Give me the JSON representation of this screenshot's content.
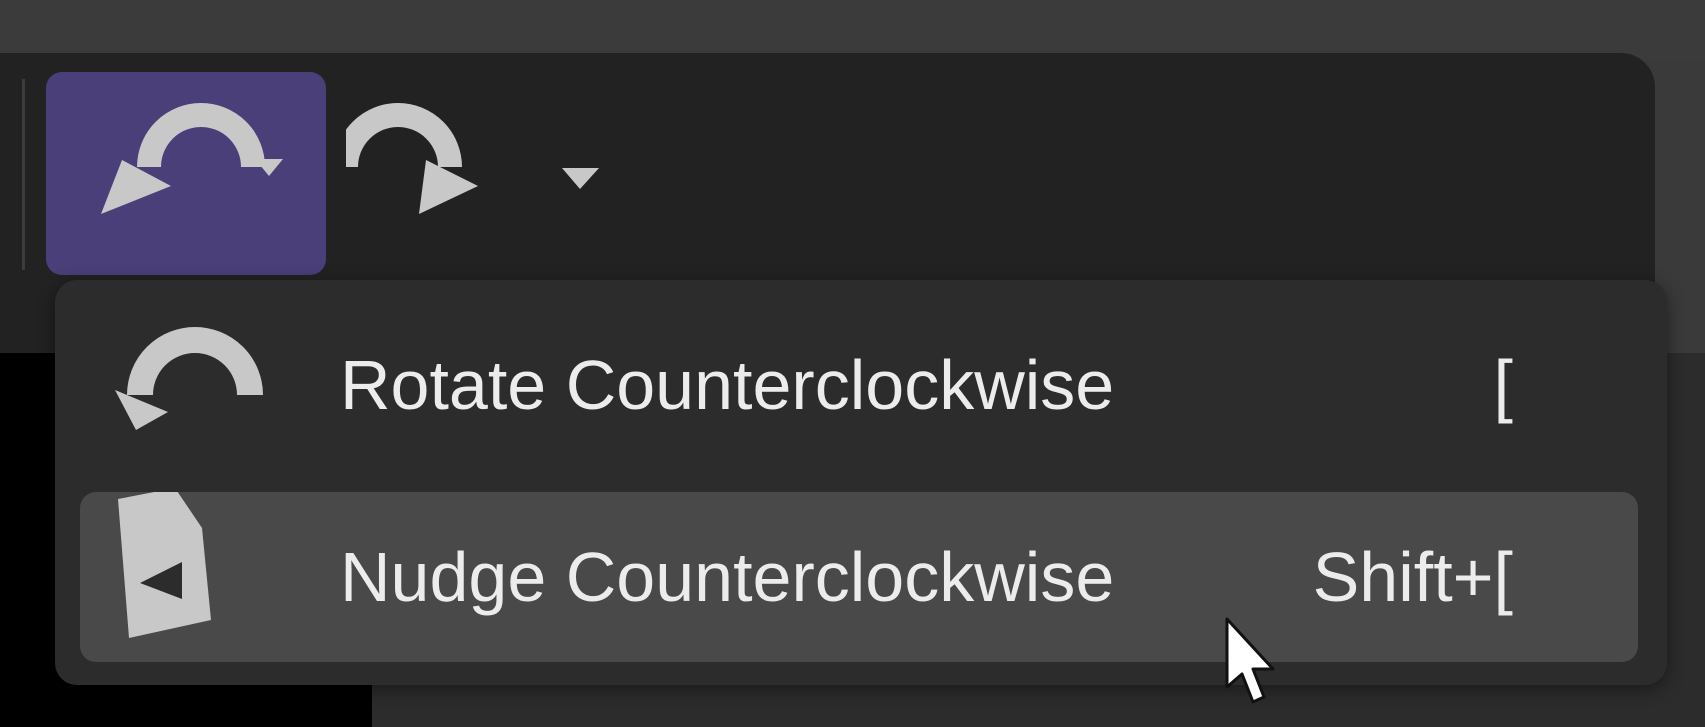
{
  "toolbar": {
    "rotate_ccw_button": {
      "icon": "rotate-counterclockwise-icon",
      "dropdown_icon": "chevron-down-icon",
      "active": true
    },
    "rotate_cw_button": {
      "icon": "rotate-clockwise-icon",
      "dropdown_icon": "chevron-down-icon",
      "active": false
    }
  },
  "menu": {
    "items": [
      {
        "label": "Rotate Counterclockwise",
        "shortcut": "[",
        "icon": "rotate-counterclockwise-icon",
        "highlighted": false
      },
      {
        "label": "Nudge Counterclockwise",
        "shortcut": "Shift+[",
        "icon": "nudge-counterclockwise-icon",
        "highlighted": true
      }
    ]
  },
  "colors": {
    "toolbar_bg": "#222222",
    "active_button_bg": "#4a3f78",
    "menu_bg": "#2c2c2c",
    "menu_highlight_bg": "#494949",
    "icon_fill": "#c8c8c8",
    "text": "#ececec"
  }
}
